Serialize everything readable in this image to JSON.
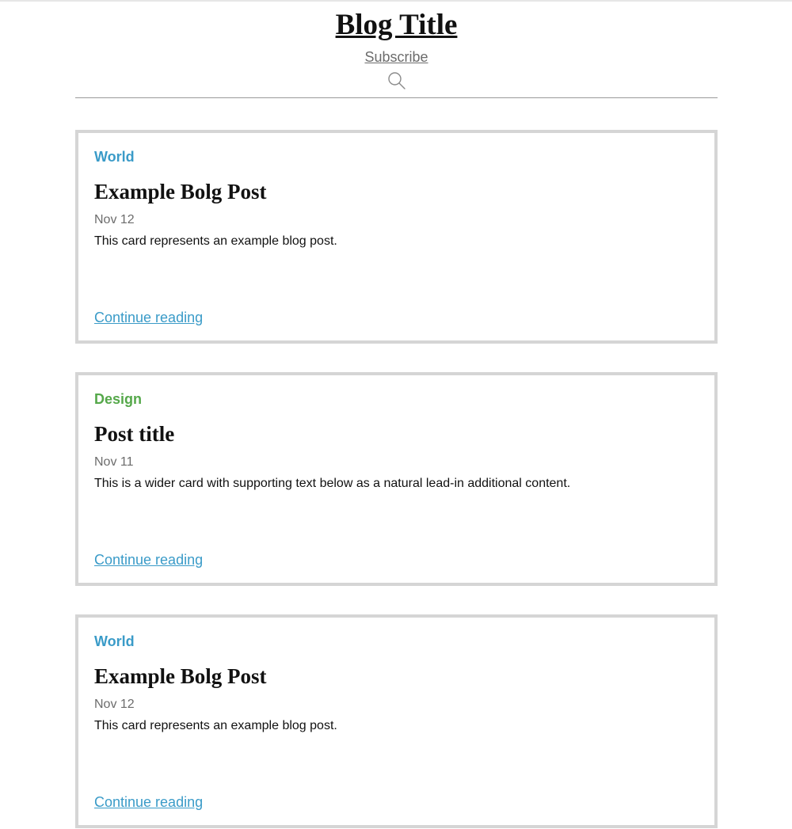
{
  "header": {
    "title": "Blog Title",
    "subscribe_label": "Subscribe",
    "search_icon": "search-icon"
  },
  "colors": {
    "world": "#3a9bc8",
    "design": "#55a84a",
    "link": "#3a9bc8",
    "border": "#d5d5d5"
  },
  "posts": [
    {
      "category": "World",
      "category_color": "#3a9bc8",
      "title": "Example Bolg Post",
      "date": "Nov 12",
      "excerpt": "This card represents an example blog post.",
      "link_label": "Continue reading"
    },
    {
      "category": "Design",
      "category_color": "#55a84a",
      "title": "Post title",
      "date": "Nov 11",
      "excerpt": "This is a wider card with supporting text below as a natural lead-in additional content.",
      "link_label": "Continue reading"
    },
    {
      "category": "World",
      "category_color": "#3a9bc8",
      "title": "Example Bolg Post",
      "date": "Nov 12",
      "excerpt": "This card represents an example blog post.",
      "link_label": "Continue reading"
    }
  ]
}
